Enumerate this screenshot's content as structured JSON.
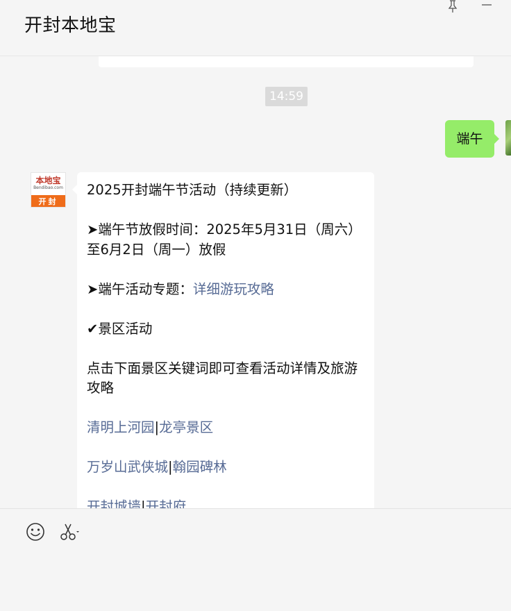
{
  "header": {
    "title": "开封本地宝"
  },
  "window_controls": {
    "pin_icon": "pin-icon",
    "minimize_icon": "minimize-icon"
  },
  "chat": {
    "timestamp": "14:59",
    "my_message": {
      "text": "端午"
    },
    "sender_avatar": {
      "logo_text": "本地宝",
      "logo_url": "Bendibao.com",
      "city": "开封"
    },
    "article": {
      "title": "2025开封端午节活动（持续更新）",
      "holiday_line": "➤端午节放假时间：2025年5月31日（周六）至6月2日（周一）放假",
      "topic_prefix": "➤端午活动专题：",
      "topic_link": "详细游玩攻略",
      "section_heading": "✔景区活动",
      "instruction": "点击下面景区关键词即可查看活动详情及旅游攻略",
      "separator": "|",
      "link_row1": [
        "清明上河园",
        "龙亭景区"
      ],
      "link_row2": [
        "万岁山武侠城",
        "翰园碑林"
      ],
      "link_row3": [
        "开封城墙",
        "开封府"
      ]
    }
  },
  "toolbar": {
    "emoji_icon": "emoji-icon",
    "screenshot_icon": "scissors-icon"
  },
  "colors": {
    "background": "#f5f5f5",
    "my_bubble": "#95ec69",
    "link": "#576b95",
    "avatar_orange": "#ef6c1a"
  }
}
